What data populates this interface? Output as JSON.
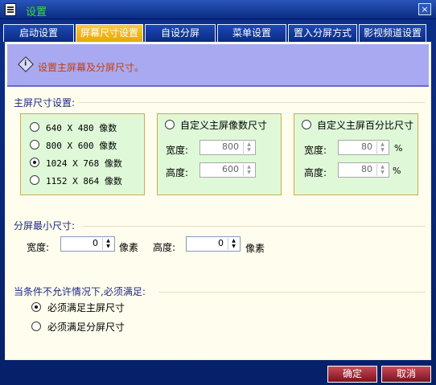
{
  "window": {
    "title": "设置",
    "close_glyph": "×"
  },
  "tabs": [
    {
      "label": "启动设置"
    },
    {
      "label": "屏幕尺寸设置"
    },
    {
      "label": "自设分屏"
    },
    {
      "label": "菜单设置"
    },
    {
      "label": "置入分屏方式"
    },
    {
      "label": "影视频道设置"
    }
  ],
  "hint": {
    "icon": "info-diamond-icon",
    "text": "设置主屏幕及分屏尺寸。"
  },
  "main_size": {
    "label": "主屏尺寸设置:",
    "presets": [
      {
        "label": "640 X 480 像数",
        "checked": false
      },
      {
        "label": "800 X 600 像数",
        "checked": false
      },
      {
        "label": "1024 X 768 像数",
        "checked": true
      },
      {
        "label": "1152 X 864 像数",
        "checked": false
      }
    ],
    "custom_pixels": {
      "label": "自定义主屏像数尺寸",
      "width_label": "宽度:",
      "width_value": "800",
      "height_label": "高度:",
      "height_value": "600"
    },
    "custom_percent": {
      "label": "自定义主屏百分比尺寸",
      "width_label": "宽度:",
      "width_value": "80",
      "width_unit": "%",
      "height_label": "高度:",
      "height_value": "80",
      "height_unit": "%"
    }
  },
  "split_min": {
    "label": "分屏最小尺寸:",
    "width_label": "宽度:",
    "width_value": "0",
    "width_unit": "像素",
    "height_label": "高度:",
    "height_value": "0",
    "height_unit": "像素"
  },
  "conflict": {
    "label": "当条件不允许情况下,必须满足:",
    "options": [
      {
        "label": "必须满足主屏尺寸",
        "checked": true
      },
      {
        "label": "必须满足分屏尺寸",
        "checked": false
      }
    ]
  },
  "footer": {
    "ok_label": "确定",
    "cancel_label": "取消"
  },
  "colors": {
    "accent_tab": "#ffc741",
    "panel_bg": "#fffded",
    "group_bg": "#dff9d8",
    "window_bg": "#08246b"
  }
}
